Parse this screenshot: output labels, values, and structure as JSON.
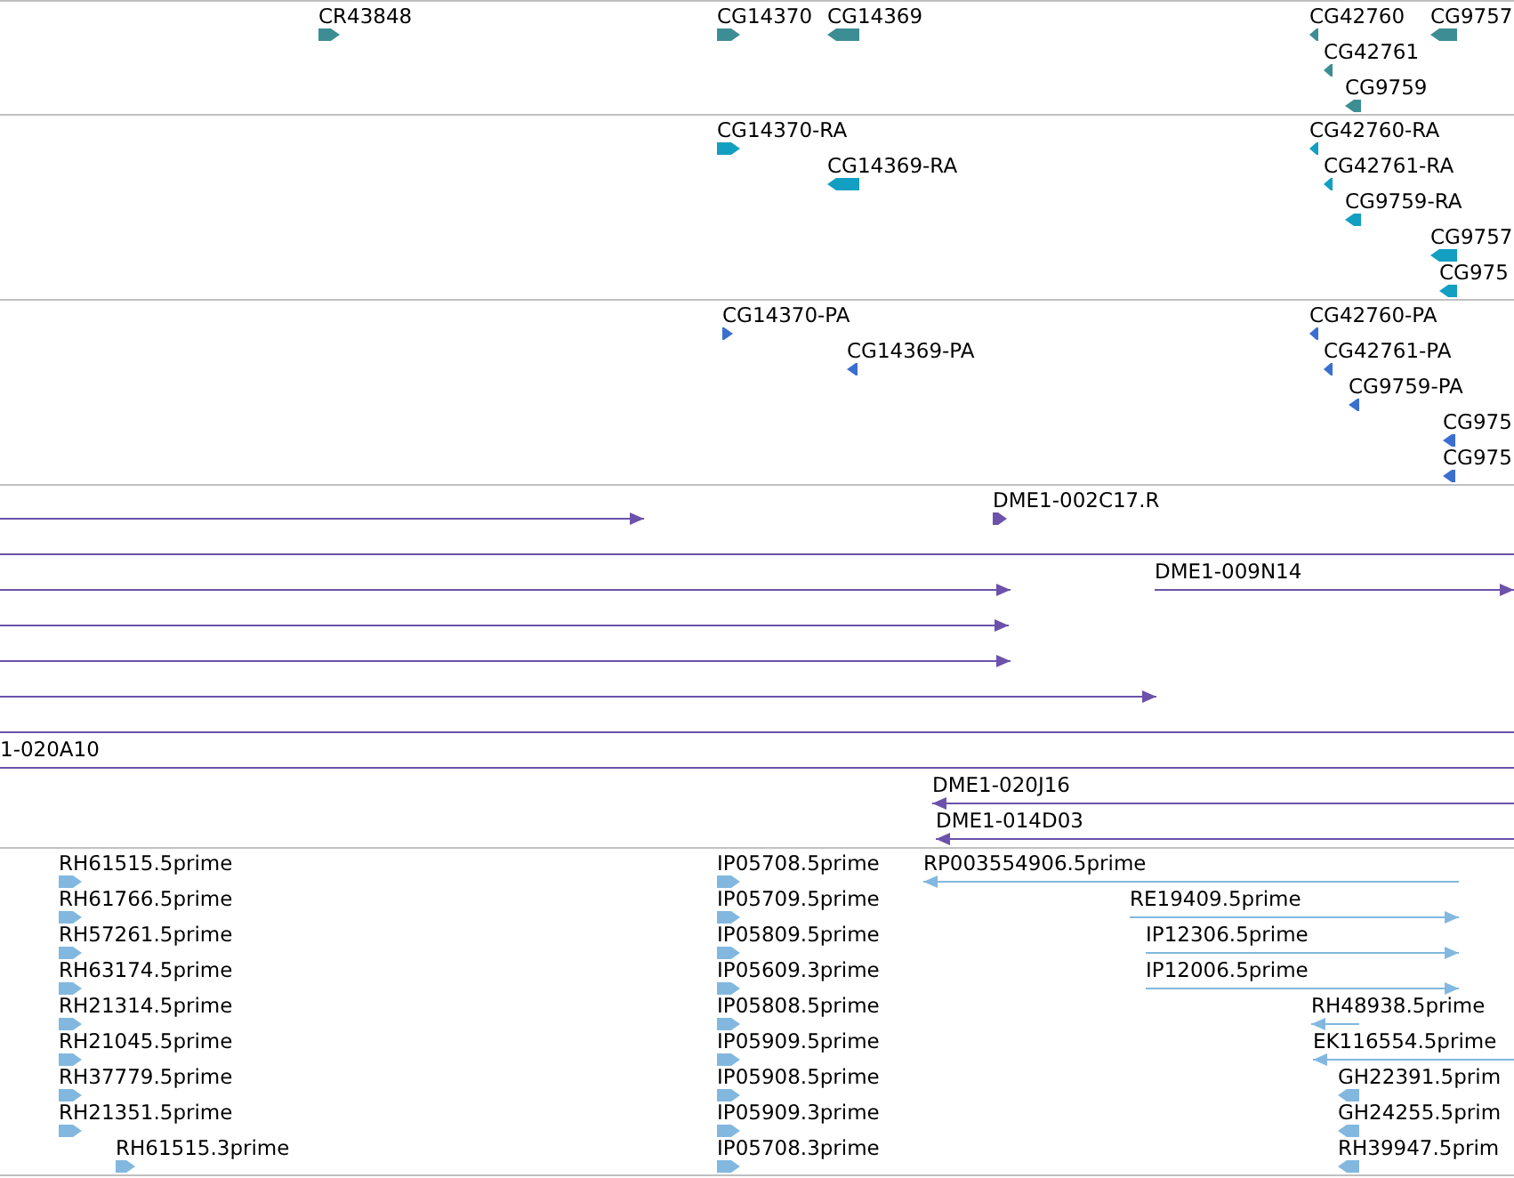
{
  "tracks": [
    {
      "kind": "gene",
      "features": [
        {
          "label": "CR43848",
          "reverse": false,
          "kind": "block"
        },
        {
          "label": "CG14370",
          "reverse": false,
          "kind": "block"
        },
        {
          "label": "CG14369",
          "reverse": true,
          "kind": "block"
        },
        {
          "label": "CG42760",
          "reverse": true,
          "kind": "block"
        },
        {
          "label": "CG9757",
          "reverse": true,
          "kind": "block"
        },
        {
          "label": "CG42761",
          "reverse": true,
          "kind": "block"
        },
        {
          "label": "CG9759",
          "reverse": true,
          "kind": "block"
        }
      ]
    },
    {
      "kind": "mrna",
      "features": [
        {
          "label": "CG14370-RA",
          "reverse": false,
          "kind": "block"
        },
        {
          "label": "CG42760-RA",
          "reverse": true,
          "kind": "block"
        },
        {
          "label": "CG14369-RA",
          "reverse": true,
          "kind": "block"
        },
        {
          "label": "CG42761-RA",
          "reverse": true,
          "kind": "block"
        },
        {
          "label": "CG9759-RA",
          "reverse": true,
          "kind": "block"
        },
        {
          "label": "CG9757",
          "reverse": true,
          "kind": "block"
        },
        {
          "label": "CG975",
          "reverse": true,
          "kind": "block"
        }
      ]
    },
    {
      "kind": "protein",
      "features": [
        {
          "label": "CG14370-PA",
          "reverse": false,
          "kind": "block"
        },
        {
          "label": "CG42760-PA",
          "reverse": true,
          "kind": "block"
        },
        {
          "label": "CG14369-PA",
          "reverse": true,
          "kind": "block"
        },
        {
          "label": "CG42761-PA",
          "reverse": true,
          "kind": "block"
        },
        {
          "label": "CG9759-PA",
          "reverse": true,
          "kind": "block"
        },
        {
          "label": "CG975",
          "reverse": true,
          "kind": "block"
        },
        {
          "label": "CG975",
          "reverse": true,
          "kind": "block"
        }
      ]
    },
    {
      "kind": "clone",
      "features": [
        {
          "reverse": false,
          "headed": true,
          "kind": "line"
        },
        {
          "label": "DME1-002C17.R",
          "reverse": false,
          "kind": "block"
        },
        {
          "headed": false,
          "kind": "line"
        },
        {
          "reverse": false,
          "headed": true,
          "kind": "line"
        },
        {
          "label": "DME1-009N14",
          "reverse": false,
          "headed": true,
          "kind": "line"
        },
        {
          "reverse": false,
          "headed": true,
          "kind": "line"
        },
        {
          "reverse": false,
          "headed": true,
          "kind": "line"
        },
        {
          "reverse": false,
          "headed": true,
          "kind": "line"
        },
        {
          "headed": false,
          "kind": "line"
        },
        {
          "label": "1-020A10",
          "headed": false,
          "kind": "line"
        },
        {
          "label": "DME1-020J16",
          "reverse": true,
          "headed": true,
          "kind": "line"
        },
        {
          "label": "DME1-014D03",
          "reverse": true,
          "headed": true,
          "kind": "line"
        }
      ]
    },
    {
      "kind": "est",
      "features": [
        {
          "label": "RH61515.5prime",
          "reverse": false,
          "kind": "block"
        },
        {
          "label": "RH61766.5prime",
          "reverse": false,
          "kind": "block"
        },
        {
          "label": "RH57261.5prime",
          "reverse": false,
          "kind": "block"
        },
        {
          "label": "RH63174.5prime",
          "reverse": false,
          "kind": "block"
        },
        {
          "label": "RH21314.5prime",
          "reverse": false,
          "kind": "block"
        },
        {
          "label": "RH21045.5prime",
          "reverse": false,
          "kind": "block"
        },
        {
          "label": "RH37779.5prime",
          "reverse": false,
          "kind": "block"
        },
        {
          "label": "RH21351.5prime",
          "reverse": false,
          "kind": "block"
        },
        {
          "label": "RH61515.3prime",
          "reverse": false,
          "kind": "block"
        },
        {
          "label": "IP05708.5prime",
          "reverse": false,
          "kind": "block"
        },
        {
          "label": "IP05709.5prime",
          "reverse": false,
          "kind": "block"
        },
        {
          "label": "IP05809.5prime",
          "reverse": false,
          "kind": "block"
        },
        {
          "label": "IP05609.3prime",
          "reverse": false,
          "kind": "block"
        },
        {
          "label": "IP05808.5prime",
          "reverse": false,
          "kind": "block"
        },
        {
          "label": "IP05909.5prime",
          "reverse": false,
          "kind": "block"
        },
        {
          "label": "IP05908.5prime",
          "reverse": false,
          "kind": "block"
        },
        {
          "label": "IP05909.3prime",
          "reverse": false,
          "kind": "block"
        },
        {
          "label": "IP05708.3prime",
          "reverse": false,
          "kind": "block"
        },
        {
          "label": "RP003554906.5prime",
          "reverse": true,
          "headed": true,
          "kind": "line"
        },
        {
          "label": "RE19409.5prime",
          "reverse": false,
          "headed": true,
          "kind": "line"
        },
        {
          "label": "IP12306.5prime",
          "reverse": false,
          "headed": true,
          "kind": "line"
        },
        {
          "label": "IP12006.5prime",
          "reverse": false,
          "headed": true,
          "kind": "line"
        },
        {
          "label": "RH48938.5prime",
          "reverse": true,
          "headed": true,
          "kind": "line"
        },
        {
          "label": "EK116554.5prime",
          "reverse": true,
          "headed": true,
          "kind": "line"
        },
        {
          "label": "GH22391.5prim",
          "reverse": true,
          "kind": "block"
        },
        {
          "label": "GH24255.5prim",
          "reverse": true,
          "kind": "block"
        },
        {
          "label": "RH39947.5prim",
          "reverse": true,
          "kind": "block"
        }
      ]
    }
  ]
}
